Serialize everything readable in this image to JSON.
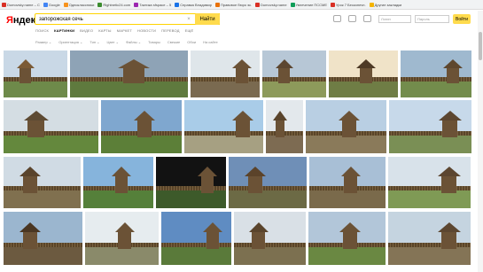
{
  "bookmarks": [
    {
      "label": "Dumovsky.name – С",
      "color": "#d93025"
    },
    {
      "label": "Google",
      "color": "#4285f4"
    },
    {
      "label": "Одноклассники",
      "color": "#f7931e"
    },
    {
      "label": "Rightnetic24.com",
      "color": "#3c8d2f"
    },
    {
      "label": "Тактика sfspace – 5",
      "color": "#9c27b0"
    },
    {
      "label": "Справка Владимир",
      "color": "#1a73e8"
    },
    {
      "label": "Правовое бюро эк.",
      "color": "#e8710a"
    },
    {
      "label": "Dumovsky.name",
      "color": "#d93025"
    },
    {
      "label": "Увлечение ПССМЕ",
      "color": "#0f9d58"
    },
    {
      "label": "Урок 7 Бесконечн.",
      "color": "#d93025"
    },
    {
      "label": "Другие закладки",
      "color": "#f4b400"
    }
  ],
  "logo": {
    "first": "Я",
    "rest": "ндекс"
  },
  "search": {
    "query": "запорожская сечь",
    "clear": "×",
    "button": "Найти"
  },
  "tabs": [
    "ПОИСК",
    "КАРТИНКИ",
    "ВИДЕО",
    "КАРТЫ",
    "МАРКЕТ",
    "НОВОСТИ",
    "ПЕРЕВОД",
    "ЕЩЁ"
  ],
  "active_tab_index": 1,
  "filters": [
    "Размер ⌄",
    "Ориентация ⌄",
    "Тип ⌄",
    "Цвет ⌄",
    "Файлы ⌄",
    "Товары",
    "Свежие",
    "Обои",
    "На сайте"
  ],
  "login": {
    "login_placeholder": "Логин",
    "password_placeholder": "Пароль",
    "button": "Войти"
  },
  "results": [
    {
      "sky": "#c9d8e6",
      "ground": "#6e8a4a",
      "roof": "#7b5a35"
    },
    {
      "sky": "#8ea3b6",
      "ground": "#5f7a3e",
      "roof": "#6b5236"
    },
    {
      "sky": "#dfe6ea",
      "ground": "#7a6a50",
      "roof": "#6b5236"
    },
    {
      "sky": "#b7c7d6",
      "ground": "#8d9a5b",
      "roof": "#5c4630"
    },
    {
      "sky": "#f0e3c8",
      "ground": "#6f7d45",
      "roof": "#4e3a26"
    },
    {
      "sky": "#9fb9cf",
      "ground": "#738c4c",
      "roof": "#5e472e"
    },
    {
      "sky": "#d4dde3",
      "ground": "#64883d",
      "roof": "#5d4a33"
    },
    {
      "sky": "#7fa7cf",
      "ground": "#5c7f38",
      "roof": "#6b5236"
    },
    {
      "sky": "#a9cce8",
      "ground": "#a6a082",
      "roof": "#6b5236"
    },
    {
      "sky": "#e3e8ec",
      "ground": "#7d6b52",
      "roof": "#5a442c"
    },
    {
      "sky": "#b9cfe3",
      "ground": "#8a7a5a",
      "roof": "#6b5236"
    },
    {
      "sky": "#c7d9ea",
      "ground": "#7a8f55",
      "roof": "#5c4630"
    },
    {
      "sky": "#d0dbe4",
      "ground": "#80704f",
      "roof": "#5a442c"
    },
    {
      "sky": "#86b4dc",
      "ground": "#55803a",
      "roof": "#6b5236"
    },
    {
      "sky": "#121212",
      "ground": "#3d5a2a",
      "roof": "#6b5236"
    },
    {
      "sky": "#6f8fb7",
      "ground": "#6c6a45",
      "roof": "#5b432a"
    },
    {
      "sky": "#a8bfd6",
      "ground": "#7a6a4b",
      "roof": "#6b5236"
    },
    {
      "sky": "#d8e2ea",
      "ground": "#7f9a55",
      "roof": "#5c4630"
    },
    {
      "sky": "#9bb6cf",
      "ground": "#6c5a40",
      "roof": "#4a3622"
    },
    {
      "sky": "#e6ecef",
      "ground": "#8a8a6a",
      "roof": "#6b5236"
    },
    {
      "sky": "#5f8cc2",
      "ground": "#5a7a3a",
      "roof": "#6b5236"
    },
    {
      "sky": "#d9e0e6",
      "ground": "#7c7050",
      "roof": "#5a442c"
    },
    {
      "sky": "#b2c6d9",
      "ground": "#6a8842",
      "roof": "#6b5236"
    },
    {
      "sky": "#c5d4e0",
      "ground": "#847456",
      "roof": "#5c4630"
    }
  ]
}
